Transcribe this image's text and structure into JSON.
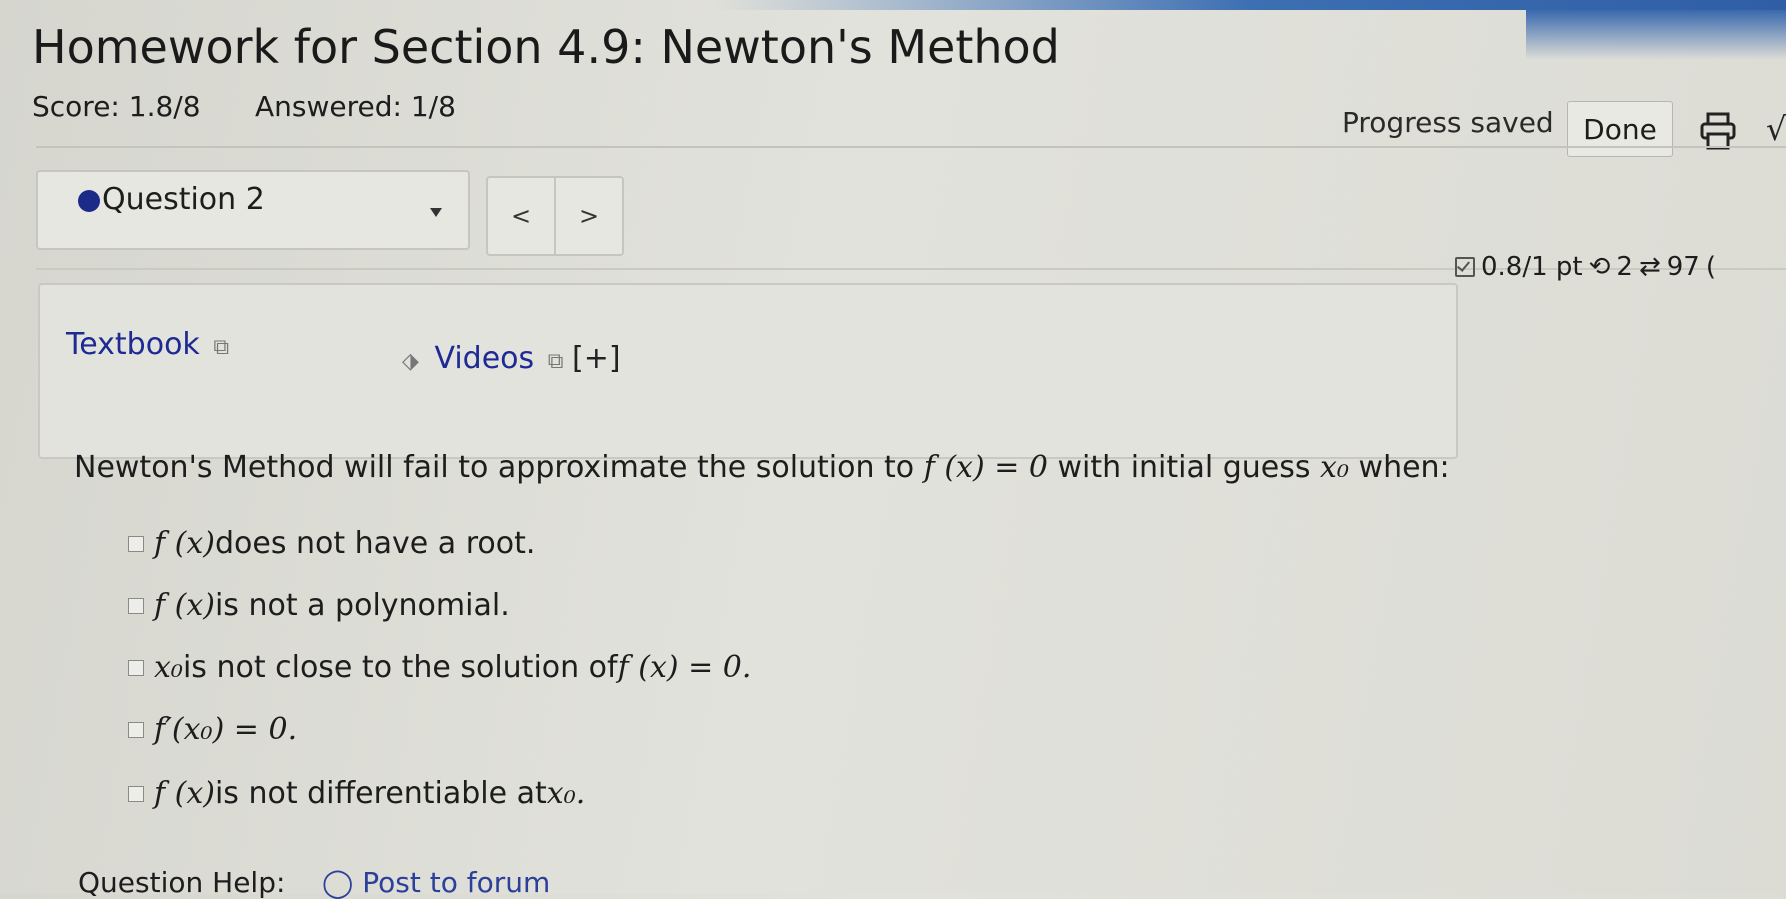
{
  "header": {
    "title": "Homework for Section 4.9: Newton's Method",
    "score": "Score: 1.8/8",
    "answered": "Answered: 1/8",
    "progress": "Progress saved",
    "done_label": "Done",
    "cut_glyph": "√"
  },
  "question_nav": {
    "selected": "Question 2",
    "prev": "<",
    "next": ">"
  },
  "meta": {
    "points": "0.8/1 pt",
    "retries": "2",
    "attempts": "97",
    "cut_glyph": "("
  },
  "resources": {
    "textbook": "Textbook",
    "videos": "Videos",
    "plus": "[+]"
  },
  "question": {
    "prefix": "Newton's Method will fail to approximate the solution to ",
    "equation": "f (x) = 0",
    "middle": " with initial guess ",
    "var": "x₀",
    "suffix": " when:"
  },
  "options": [
    {
      "math": "f (x)",
      "text": " does not have a root."
    },
    {
      "math": "f (x)",
      "text": " is not a polynomial."
    },
    {
      "math": "x₀",
      "text": " is not close to the solution of ",
      "math2": "f (x) = 0."
    },
    {
      "math": "f′(x₀) = 0.",
      "text": ""
    },
    {
      "math": "f (x)",
      "text": " is not differentiable at ",
      "math2": "x₀."
    }
  ],
  "footer": {
    "help": "Question Help:",
    "forum": "Post to forum"
  },
  "icons": [
    "printer-icon",
    "checkbox-icon",
    "retry-icon",
    "attempts-icon",
    "external-link-icon",
    "video-icon",
    "forum-icon"
  ],
  "colors": {
    "link": "#1e2a93",
    "accent": "#1c2a88",
    "top_band": "#3d6fb3"
  }
}
